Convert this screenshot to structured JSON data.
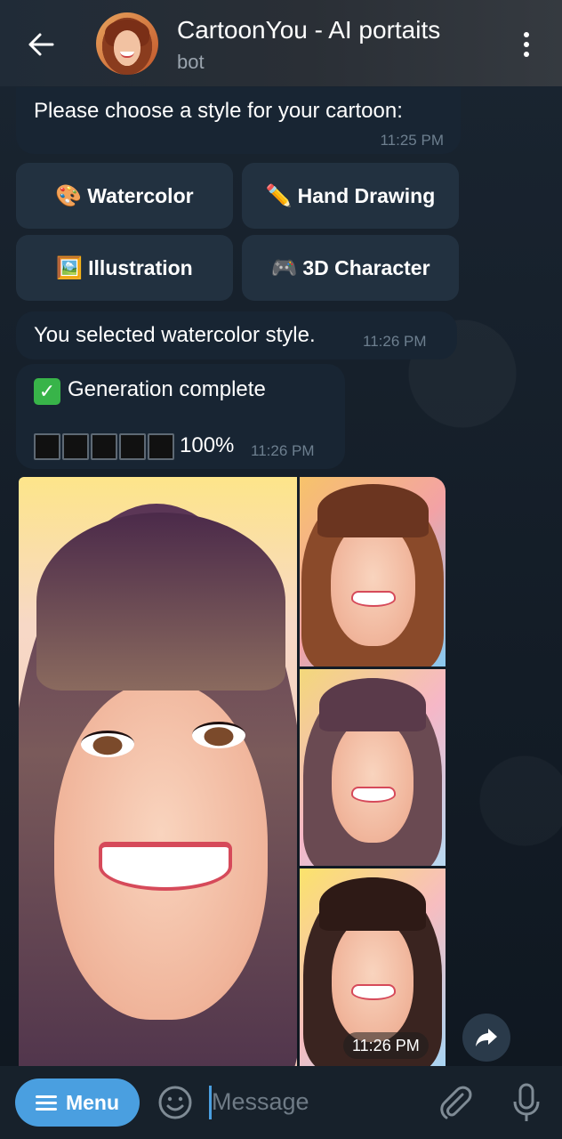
{
  "header": {
    "title": "CartoonYou - AI portaits",
    "subtitle": "bot"
  },
  "messages": {
    "choose_style": {
      "text": "Please choose a style for your cartoon:",
      "time": "11:25 PM"
    },
    "selected": {
      "text": "You selected watercolor style.",
      "time": "11:26 PM"
    },
    "generation": {
      "text": "Generation complete",
      "progress": "100%",
      "time": "11:26 PM"
    },
    "album": {
      "time": "11:26 PM"
    }
  },
  "keyboard": [
    {
      "icon": "🎨",
      "label": "Watercolor"
    },
    {
      "icon": "✏️",
      "label": "Hand Drawing"
    },
    {
      "icon": "🖼️",
      "label": "Illustration"
    },
    {
      "icon": "🎮",
      "label": "3D Character"
    }
  ],
  "input_bar": {
    "menu_label": "Menu",
    "placeholder": "Message"
  },
  "colors": {
    "accent": "#4a9fe0",
    "bubble": "#182533",
    "check": "#38b449"
  }
}
